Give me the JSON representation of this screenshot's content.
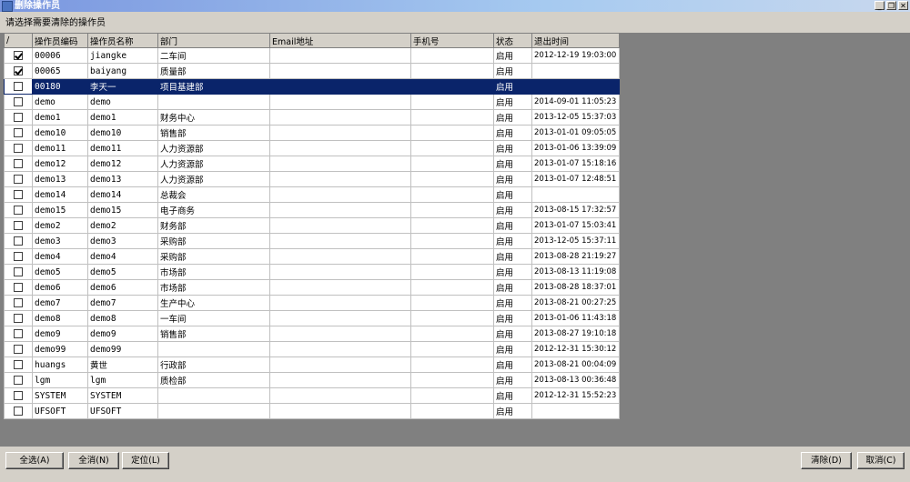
{
  "window": {
    "title": "删除操作员"
  },
  "prompt": "请选择需要清除的操作员",
  "columns": [
    "/",
    "操作员编码",
    "操作员名称",
    "部门",
    "Email地址",
    "手机号",
    "状态",
    "退出时间"
  ],
  "rows": [
    {
      "checked": true,
      "code": "00006",
      "name": "jiangke",
      "dept": "二车间",
      "email": "",
      "phone": "",
      "status": "启用",
      "exit": "2012-12-19 19:03:00"
    },
    {
      "checked": true,
      "code": "00065",
      "name": "baiyang",
      "dept": "质量部",
      "email": "",
      "phone": "",
      "status": "启用",
      "exit": ""
    },
    {
      "checked": false,
      "code": "00180",
      "name": "李天一",
      "dept": "项目基建部",
      "email": "",
      "phone": "",
      "status": "启用",
      "exit": "",
      "selected": true
    },
    {
      "checked": false,
      "code": "demo",
      "name": "demo",
      "dept": "",
      "email": "",
      "phone": "",
      "status": "启用",
      "exit": "2014-09-01 11:05:23"
    },
    {
      "checked": false,
      "code": "demo1",
      "name": "demo1",
      "dept": "财务中心",
      "email": "",
      "phone": "",
      "status": "启用",
      "exit": "2013-12-05 15:37:03"
    },
    {
      "checked": false,
      "code": "demo10",
      "name": "demo10",
      "dept": "销售部",
      "email": "",
      "phone": "",
      "status": "启用",
      "exit": "2013-01-01 09:05:05"
    },
    {
      "checked": false,
      "code": "demo11",
      "name": "demo11",
      "dept": "人力资源部",
      "email": "",
      "phone": "",
      "status": "启用",
      "exit": "2013-01-06 13:39:09"
    },
    {
      "checked": false,
      "code": "demo12",
      "name": "demo12",
      "dept": "人力资源部",
      "email": "",
      "phone": "",
      "status": "启用",
      "exit": "2013-01-07 15:18:16"
    },
    {
      "checked": false,
      "code": "demo13",
      "name": "demo13",
      "dept": "人力资源部",
      "email": "",
      "phone": "",
      "status": "启用",
      "exit": "2013-01-07 12:48:51"
    },
    {
      "checked": false,
      "code": "demo14",
      "name": "demo14",
      "dept": "总裁会",
      "email": "",
      "phone": "",
      "status": "启用",
      "exit": ""
    },
    {
      "checked": false,
      "code": "demo15",
      "name": "demo15",
      "dept": "电子商务",
      "email": "",
      "phone": "",
      "status": "启用",
      "exit": "2013-08-15 17:32:57"
    },
    {
      "checked": false,
      "code": "demo2",
      "name": "demo2",
      "dept": "财务部",
      "email": "",
      "phone": "",
      "status": "启用",
      "exit": "2013-01-07 15:03:41"
    },
    {
      "checked": false,
      "code": "demo3",
      "name": "demo3",
      "dept": "采购部",
      "email": "",
      "phone": "",
      "status": "启用",
      "exit": "2013-12-05 15:37:11"
    },
    {
      "checked": false,
      "code": "demo4",
      "name": "demo4",
      "dept": "采购部",
      "email": "",
      "phone": "",
      "status": "启用",
      "exit": "2013-08-28 21:19:27"
    },
    {
      "checked": false,
      "code": "demo5",
      "name": "demo5",
      "dept": "市场部",
      "email": "",
      "phone": "",
      "status": "启用",
      "exit": "2013-08-13 11:19:08"
    },
    {
      "checked": false,
      "code": "demo6",
      "name": "demo6",
      "dept": "市场部",
      "email": "",
      "phone": "",
      "status": "启用",
      "exit": "2013-08-28 18:37:01"
    },
    {
      "checked": false,
      "code": "demo7",
      "name": "demo7",
      "dept": "生产中心",
      "email": "",
      "phone": "",
      "status": "启用",
      "exit": "2013-08-21 00:27:25"
    },
    {
      "checked": false,
      "code": "demo8",
      "name": "demo8",
      "dept": "一车间",
      "email": "",
      "phone": "",
      "status": "启用",
      "exit": "2013-01-06 11:43:18"
    },
    {
      "checked": false,
      "code": "demo9",
      "name": "demo9",
      "dept": "销售部",
      "email": "",
      "phone": "",
      "status": "启用",
      "exit": "2013-08-27 19:10:18"
    },
    {
      "checked": false,
      "code": "demo99",
      "name": "demo99",
      "dept": "",
      "email": "",
      "phone": "",
      "status": "启用",
      "exit": "2012-12-31 15:30:12"
    },
    {
      "checked": false,
      "code": "huangs",
      "name": "黄世",
      "dept": "行政部",
      "email": "",
      "phone": "",
      "status": "启用",
      "exit": "2013-08-21 00:04:09"
    },
    {
      "checked": false,
      "code": "lgm",
      "name": "lgm",
      "dept": "质检部",
      "email": "",
      "phone": "",
      "status": "启用",
      "exit": "2013-08-13 00:36:48"
    },
    {
      "checked": false,
      "code": "SYSTEM",
      "name": "SYSTEM",
      "dept": "",
      "email": "",
      "phone": "",
      "status": "启用",
      "exit": "2012-12-31 15:52:23"
    },
    {
      "checked": false,
      "code": "UFSOFT",
      "name": "UFSOFT",
      "dept": "",
      "email": "",
      "phone": "",
      "status": "启用",
      "exit": ""
    }
  ],
  "buttons": {
    "select_all": "全选(A)",
    "clear_all": "全消(N)",
    "locate": "定位(L)",
    "delete": "清除(D)",
    "cancel": "取消(C)"
  }
}
